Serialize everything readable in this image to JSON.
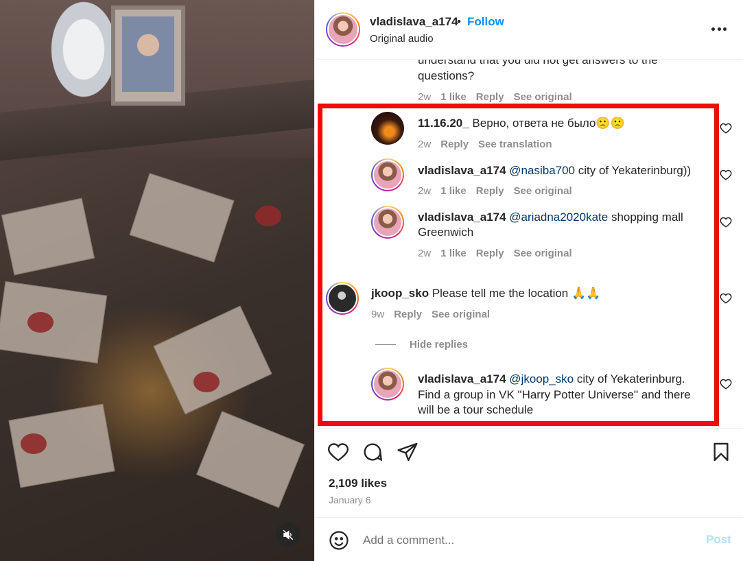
{
  "post": {
    "username": "vladislava_a174",
    "separator": "•",
    "follow_label": "Follow",
    "audio": "Original audio"
  },
  "comments": {
    "partial": {
      "line1": "understand that you did not get answers to the",
      "line2": "questions?",
      "time": "2w",
      "likes": "1 like",
      "reply": "Reply",
      "see": "See original"
    },
    "items": [
      {
        "username": "11.16.20_",
        "text": " Верно, ответа не было🙁🙁",
        "time": "2w",
        "reply": "Reply",
        "see": "See translation"
      },
      {
        "username": "vladislava_a174",
        "mention": "@nasiba700",
        "text": " city of Yekaterinburg))",
        "time": "2w",
        "likes": "1 like",
        "reply": "Reply",
        "see": "See original"
      },
      {
        "username": "vladislava_a174",
        "mention": "@ariadna2020kate",
        "text": " shopping mall",
        "text2": "Greenwich",
        "time": "2w",
        "likes": "1 like",
        "reply": "Reply",
        "see": "See original"
      },
      {
        "username": "jkoop_sko",
        "text": " Please tell me the location 🙏🙏",
        "time": "9w",
        "reply": "Reply",
        "see": "See original"
      },
      {
        "username": "vladislava_a174",
        "mention": "@jkoop_sko",
        "text": " city of Yekaterinburg.",
        "text2": "Find a group in VK \"Harry Potter Universe\" and there",
        "text3": "will be a tour schedule"
      }
    ],
    "hide_replies": "Hide replies"
  },
  "engagement": {
    "likes": "2,109 likes",
    "date": "January 6"
  },
  "composer": {
    "placeholder": "Add a comment...",
    "post_label": "Post"
  },
  "colors": {
    "accent": "#0095f6",
    "highlight": "#ee0b0b",
    "muted": "#8e8e8e",
    "mention": "#00376b"
  },
  "icons": [
    "mute-icon",
    "more-icon",
    "heart-icon",
    "comment-icon",
    "share-icon",
    "bookmark-icon",
    "emoji-icon"
  ]
}
